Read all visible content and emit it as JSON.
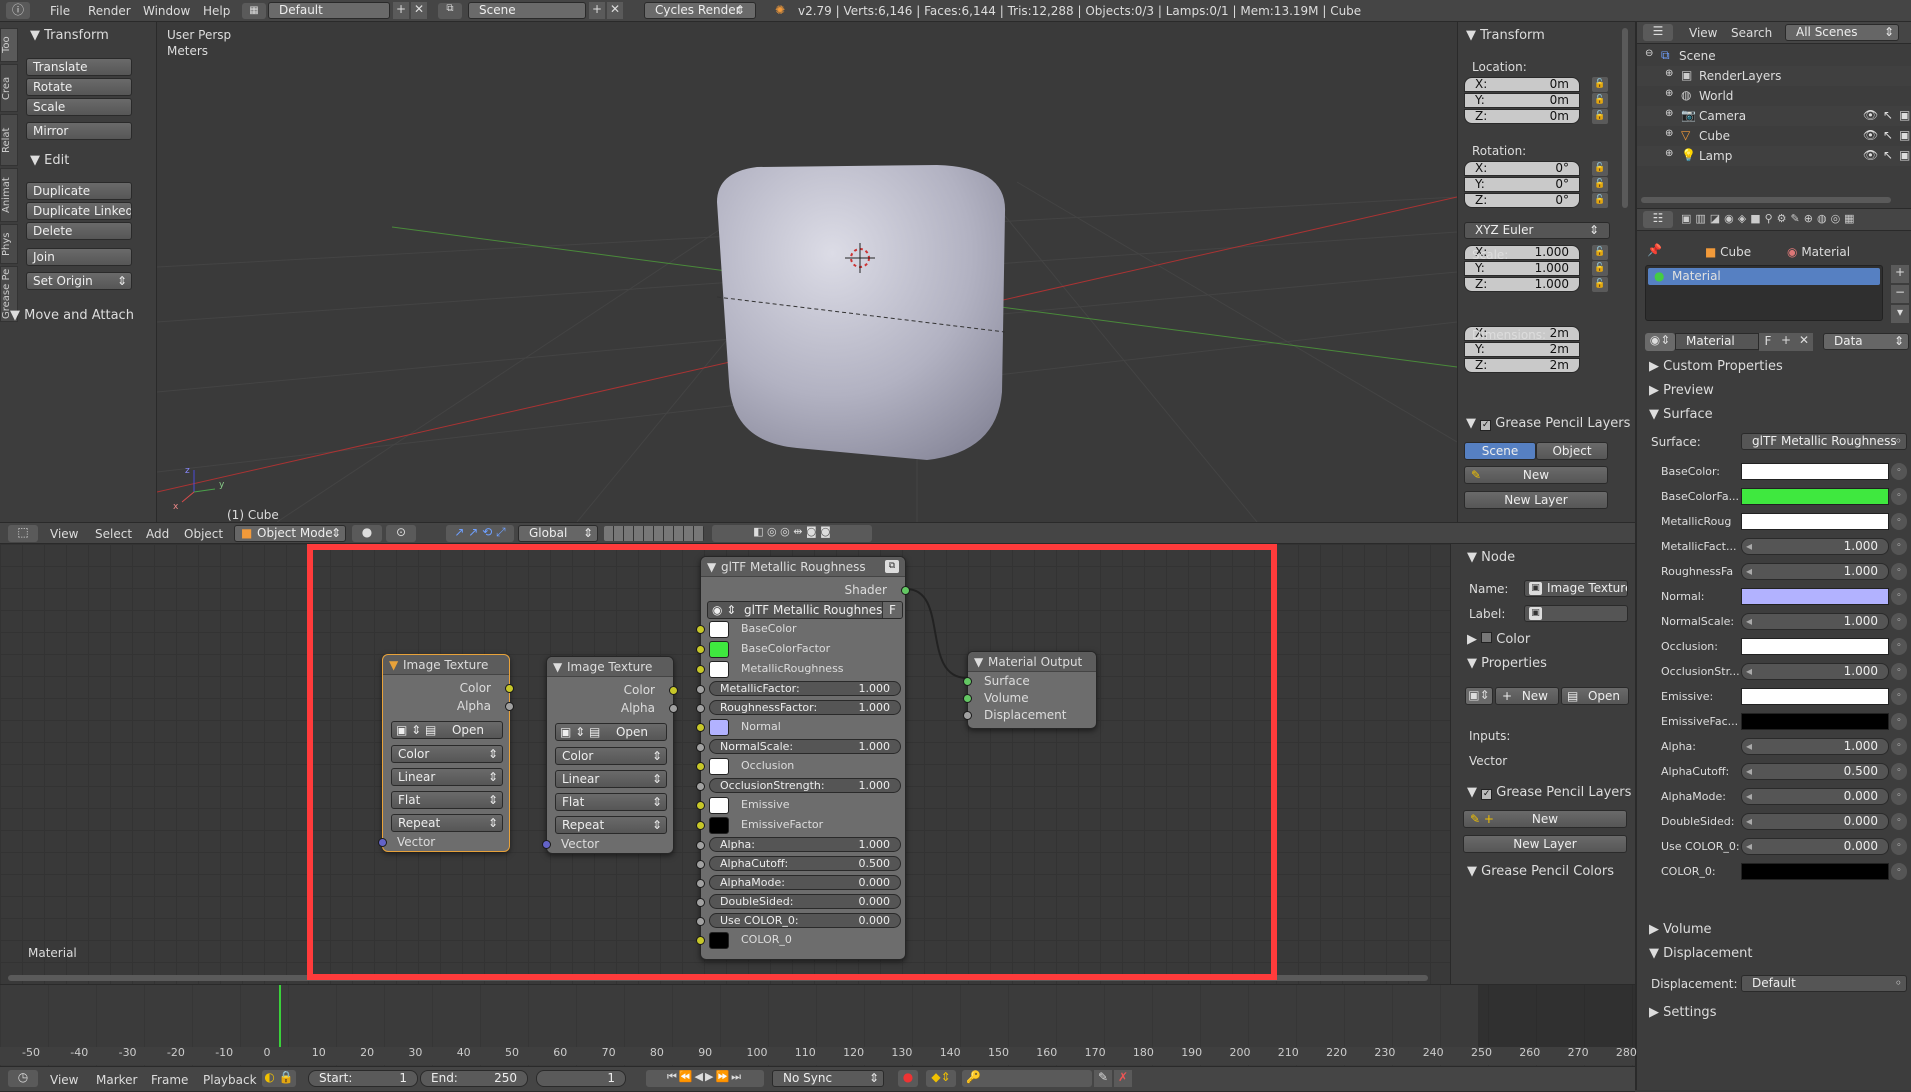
{
  "topbar": {
    "menus": [
      "File",
      "Render",
      "Window",
      "Help"
    ],
    "layout": "Default",
    "scene": "Scene",
    "engine": "Cycles Render",
    "info": "v2.79 | Verts:6,146 | Faces:6,144 | Tris:12,288 | Objects:0/3 | Lamps:0/1 | Mem:13.19M | Cube"
  },
  "toolshelf": {
    "tabs": [
      "Too",
      "Crea",
      "Relat",
      "Animat",
      "Phys",
      "Grease Pe"
    ],
    "transform_header": "Transform",
    "transform_buttons": [
      "Translate",
      "Rotate",
      "Scale",
      "Mirror"
    ],
    "edit_header": "Edit",
    "edit_buttons": [
      "Duplicate",
      "Duplicate Linked",
      "Delete",
      "Join",
      "Set Origin"
    ],
    "move_header": "Move and Attach"
  },
  "viewport": {
    "view_name": "User Persp",
    "units": "Meters",
    "object_label": "(1) Cube",
    "axis_x": "x",
    "axis_y": "y",
    "axis_z": "z"
  },
  "npanel": {
    "transform_header": "Transform",
    "location_label": "Location:",
    "location": [
      {
        "axis": "X:",
        "value": "0m"
      },
      {
        "axis": "Y:",
        "value": "0m"
      },
      {
        "axis": "Z:",
        "value": "0m"
      }
    ],
    "rotation_label": "Rotation:",
    "rotation": [
      {
        "axis": "X:",
        "value": "0°"
      },
      {
        "axis": "Y:",
        "value": "0°"
      },
      {
        "axis": "Z:",
        "value": "0°"
      }
    ],
    "rotation_mode": "XYZ Euler",
    "scale_label": "Scale:",
    "scale": [
      {
        "axis": "X:",
        "value": "1.000"
      },
      {
        "axis": "Y:",
        "value": "1.000"
      },
      {
        "axis": "Z:",
        "value": "1.000"
      }
    ],
    "dimensions_label": "Dimensions:",
    "dimensions": [
      {
        "axis": "X:",
        "value": "2m"
      },
      {
        "axis": "Y:",
        "value": "2m"
      },
      {
        "axis": "Z:",
        "value": "2m"
      }
    ],
    "gp_header": "Grease Pencil Layers",
    "gp_tab_scene": "Scene",
    "gp_tab_object": "Object",
    "gp_new": "New",
    "gp_new_layer": "New Layer"
  },
  "viewheader": {
    "menus": [
      "View",
      "Select",
      "Add",
      "Object"
    ],
    "mode": "Object Mode",
    "orientation": "Global"
  },
  "nodeeditor": {
    "label": "Material",
    "node_img1": {
      "title": "Image Texture",
      "out_color": "Color",
      "out_alpha": "Alpha",
      "open": "Open",
      "color": "Color",
      "interp": "Linear",
      "proj": "Flat",
      "ext": "Repeat",
      "in_vector": "Vector"
    },
    "node_img2": {
      "title": "Image Texture",
      "out_color": "Color",
      "out_alpha": "Alpha",
      "open": "Open",
      "color": "Color",
      "interp": "Linear",
      "proj": "Flat",
      "ext": "Repeat",
      "in_vector": "Vector"
    },
    "node_gltf": {
      "title": "glTF Metallic Roughness",
      "out_shader": "Shader",
      "group": "glTF Metallic Roughness",
      "group_f": "F",
      "rows": [
        {
          "kind": "color",
          "label": "BaseColor",
          "color": "#ffffff"
        },
        {
          "kind": "color",
          "label": "BaseColorFactor",
          "color": "#3fe83f"
        },
        {
          "kind": "color",
          "label": "MetallicRoughness",
          "color": "#ffffff"
        },
        {
          "kind": "num",
          "label": "MetallicFactor:",
          "value": "1.000"
        },
        {
          "kind": "num",
          "label": "RoughnessFactor:",
          "value": "1.000"
        },
        {
          "kind": "color",
          "label": "Normal",
          "color": "#b2b2ff"
        },
        {
          "kind": "num",
          "label": "NormalScale:",
          "value": "1.000"
        },
        {
          "kind": "color",
          "label": "Occlusion",
          "color": "#ffffff"
        },
        {
          "kind": "num",
          "label": "OcclusionStrength:",
          "value": "1.000"
        },
        {
          "kind": "color",
          "label": "Emissive",
          "color": "#ffffff"
        },
        {
          "kind": "color",
          "label": "EmissiveFactor",
          "color": "#000000"
        },
        {
          "kind": "num",
          "label": "Alpha:",
          "value": "1.000"
        },
        {
          "kind": "num",
          "label": "AlphaCutoff:",
          "value": "0.500"
        },
        {
          "kind": "num",
          "label": "AlphaMode:",
          "value": "0.000"
        },
        {
          "kind": "num",
          "label": "DoubleSided:",
          "value": "0.000"
        },
        {
          "kind": "num",
          "label": "Use COLOR_0:",
          "value": "0.000"
        },
        {
          "kind": "color",
          "label": "COLOR_0",
          "color": "#000000"
        }
      ]
    },
    "node_output": {
      "title": "Material Output",
      "surface": "Surface",
      "volume": "Volume",
      "displacement": "Displacement"
    }
  },
  "nodepanel": {
    "node_header": "Node",
    "name_label": "Name:",
    "name_value": "Image Texture",
    "label_label": "Label:",
    "color_header": "Color",
    "props_header": "Properties",
    "new": "New",
    "open": "Open",
    "inputs_label": "Inputs:",
    "vector_label": "Vector",
    "gp_header": "Grease Pencil Layers",
    "gp_new": "New",
    "gp_new_layer": "New Layer",
    "gpc_header": "Grease Pencil Colors"
  },
  "outliner": {
    "menus": [
      "View",
      "Search"
    ],
    "filter": "All Scenes",
    "items": [
      {
        "label": "Scene",
        "indent": 0
      },
      {
        "label": "RenderLayers",
        "indent": 1
      },
      {
        "label": "World",
        "indent": 1
      },
      {
        "label": "Camera",
        "indent": 1
      },
      {
        "label": "Cube",
        "indent": 1
      },
      {
        "label": "Lamp",
        "indent": 1
      }
    ]
  },
  "properties": {
    "bc_cube": "Cube",
    "bc_material": "Material",
    "slot": "Material",
    "mat_name": "Material",
    "mat_f": "F",
    "data": "Data",
    "custom_props": "Custom Properties",
    "preview": "Preview",
    "surface_header": "Surface",
    "surface_label": "Surface:",
    "surface_value": "glTF Metallic Roughness",
    "rows": [
      {
        "kind": "color",
        "label": "BaseColor:",
        "color": "#ffffff"
      },
      {
        "kind": "color",
        "label": "BaseColorFa...",
        "color": "#3fe83f"
      },
      {
        "kind": "color",
        "label": "MetallicRoug",
        "color": "#ffffff"
      },
      {
        "kind": "num",
        "label": "MetallicFact...",
        "value": "1.000"
      },
      {
        "kind": "num",
        "label": "RoughnessFa",
        "value": "1.000"
      },
      {
        "kind": "color",
        "label": "Normal:",
        "color": "#b2b2ff"
      },
      {
        "kind": "num",
        "label": "NormalScale:",
        "value": "1.000"
      },
      {
        "kind": "color",
        "label": "Occlusion:",
        "color": "#ffffff"
      },
      {
        "kind": "num",
        "label": "OcclusionStr...",
        "value": "1.000"
      },
      {
        "kind": "color",
        "label": "Emissive:",
        "color": "#ffffff"
      },
      {
        "kind": "color",
        "label": "EmissiveFac...",
        "color": "#000000"
      },
      {
        "kind": "num",
        "label": "Alpha:",
        "value": "1.000"
      },
      {
        "kind": "num",
        "label": "AlphaCutoff:",
        "value": "0.500"
      },
      {
        "kind": "num",
        "label": "AlphaMode:",
        "value": "0.000"
      },
      {
        "kind": "num",
        "label": "DoubleSided:",
        "value": "0.000"
      },
      {
        "kind": "num",
        "label": "Use COLOR_0:",
        "value": "0.000"
      },
      {
        "kind": "color",
        "label": "COLOR_0:",
        "color": "#000000"
      }
    ],
    "volume": "Volume",
    "displacement_header": "Displacement",
    "displacement_label": "Displacement:",
    "displacement_value": "Default",
    "settings": "Settings"
  },
  "timeline": {
    "ticks": [
      "-50",
      "-40",
      "-30",
      "-20",
      "-10",
      "0",
      "10",
      "20",
      "30",
      "40",
      "50",
      "60",
      "70",
      "80",
      "90",
      "100",
      "110",
      "120",
      "130",
      "140",
      "150",
      "160",
      "170",
      "180",
      "190",
      "200",
      "210",
      "220",
      "230",
      "240",
      "250",
      "260",
      "270",
      "280"
    ],
    "menus": [
      "View",
      "Marker",
      "Frame",
      "Playback"
    ],
    "start_label": "Start:",
    "start": "1",
    "end_label": "End:",
    "end": "250",
    "current": "1",
    "sync": "No Sync"
  },
  "colors": {
    "highlight": "#ff3b3b",
    "selected": "#5680c2",
    "active_node": "#e8a23a"
  }
}
